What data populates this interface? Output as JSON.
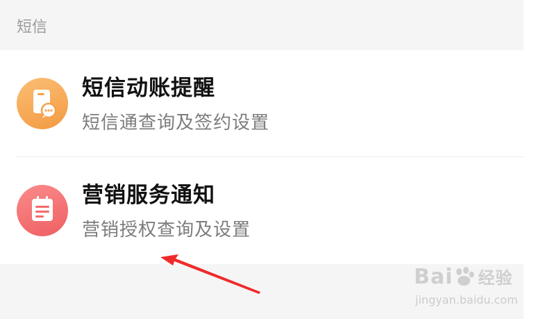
{
  "section": {
    "title": "短信"
  },
  "items": [
    {
      "title": "短信动账提醒",
      "subtitle": "短信通查询及签约设置",
      "icon": "sms-notification-icon",
      "icon_color": "#f6a24c"
    },
    {
      "title": "营销服务通知",
      "subtitle": "营销授权查询及设置",
      "icon": "notepad-icon",
      "icon_color": "#f26a6c"
    }
  ],
  "annotation": {
    "arrow_color": "#f02a2a"
  },
  "watermark": {
    "brand": "Bai",
    "brand_suffix": "经验",
    "url": "jingyan.baidu.com"
  }
}
